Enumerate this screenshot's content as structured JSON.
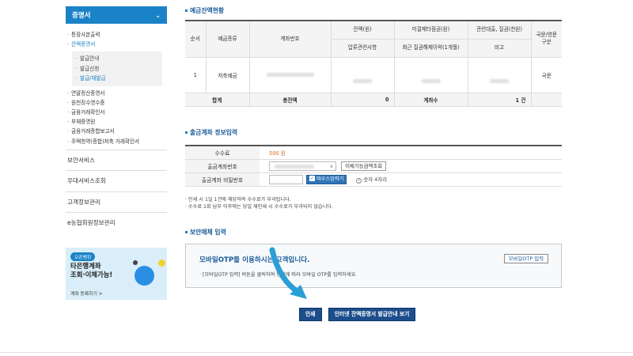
{
  "sidebar": {
    "header": "증명서",
    "menu_top": [
      "통장사본출력",
      "잔액증명서"
    ],
    "submenu": [
      "발급안내",
      "발급신청",
      "발급/재발급"
    ],
    "menu_bottom": [
      "연말정산증명서",
      "원천징수영수증",
      "금융거래확인서",
      "부채증명원",
      "금융거래종합보고서",
      "주택청약(종합)저축 거래확인서"
    ],
    "links": [
      "보안서비스",
      "우대서비스조회",
      "고객정보관리",
      "e농협회원정보관리"
    ],
    "banner": {
      "badge": "오픈뱅킹",
      "line1": "타은행계좌",
      "line2": "조회·이체가능!",
      "link": "계좌 등록하기 >"
    }
  },
  "balance": {
    "title": "예금잔액현황",
    "headers": {
      "no": "순서",
      "type": "예금종류",
      "account": "계좌번호",
      "balance": "잔액(원)",
      "unsettled": "미결제타점권(원)",
      "related_loan": "관련대출, 질권(천원)",
      "lang": "국문/영문 구분",
      "seizure": "압류관련사항",
      "recent_pledge": "최근 질권해제이력(1개월)",
      "note": "비고"
    },
    "row": {
      "no": "1",
      "type": "저축예금",
      "lang": "국문"
    },
    "total": {
      "label": "합계",
      "balance_label": "총잔액",
      "balance": "0",
      "count_label": "계좌수",
      "count": "1 건"
    }
  },
  "withdraw": {
    "title": "출금계좌 정보입력",
    "fee_label": "수수료",
    "fee_value": "500 원",
    "account_label": "출금계좌번호",
    "check_button": "이체가능금액조회",
    "pw_label": "출금계좌 비밀번호",
    "mouse_button": "마우스입력기",
    "pw_hint": "숫자 4자리",
    "notes": [
      "· 인쇄 시 1일 1건에 해당하여 수수료가 부과됩니다.",
      "· 수수료 1회 납부 이후에는 당일 재인쇄 시 수수료가 부과되지 않습니다."
    ]
  },
  "security": {
    "title": "보안매체 입력",
    "otp_title": "모바일OTP를 이용하시는 고객입니다.",
    "otp_desc": "· [모바일OTP 입력] 버튼을 클릭하여 안내에 따라 모바일 OTP를 입력하세요.",
    "otp_button": "모바일OTP 입력"
  },
  "actions": {
    "print": "인쇄",
    "guide": "인터넷 잔액증명서 발급안내 보기"
  },
  "colors": {
    "accent": "#1a82c7",
    "dark_button": "#1c4e8c",
    "fee": "#d9691a",
    "arrow": "#2a9fd6"
  }
}
